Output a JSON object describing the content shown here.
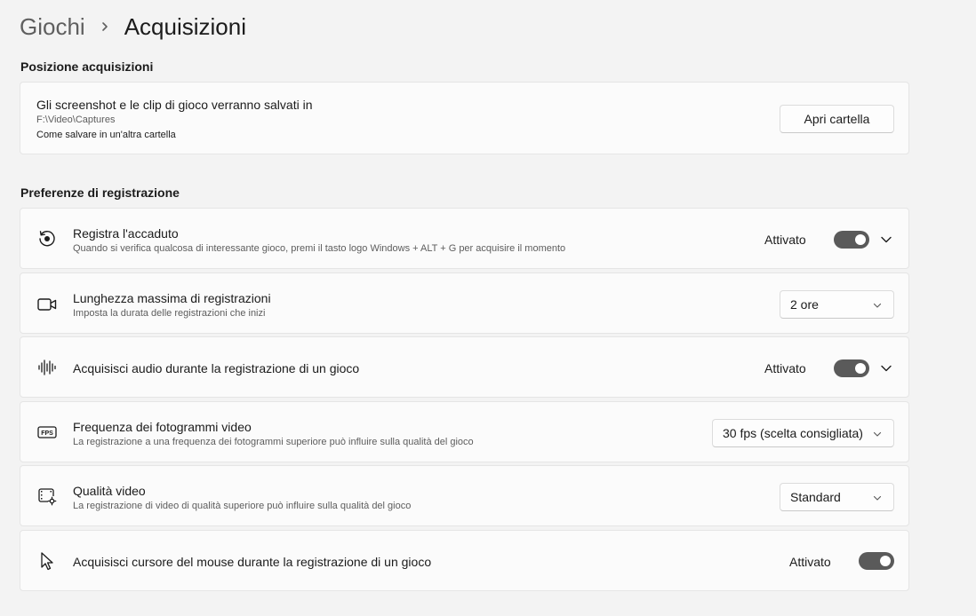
{
  "breadcrumb": {
    "parent": "Giochi",
    "current": "Acquisizioni"
  },
  "location_section": {
    "title": "Posizione acquisizioni",
    "description": "Gli screenshot e le clip di gioco verranno salvati in",
    "path": "F:\\Video\\Captures",
    "link": "Come salvare in un'altra cartella",
    "button": "Apri cartella"
  },
  "recording_section": {
    "title": "Preferenze di registrazione",
    "rows": [
      {
        "icon": "record-history-icon",
        "title": "Registra l'accaduto",
        "subtitle": "Quando si verifica qualcosa di interessante gioco, premi il tasto logo Windows + ALT + G per acquisire il momento",
        "state": "Attivato"
      },
      {
        "icon": "video-camera-icon",
        "title": "Lunghezza massima di registrazioni",
        "subtitle": "Imposta la durata delle registrazioni che inizi",
        "value": "2 ore"
      },
      {
        "icon": "audio-waveform-icon",
        "title": "Acquisisci audio durante la registrazione di un gioco",
        "state": "Attivato"
      },
      {
        "icon": "fps-icon",
        "title": "Frequenza dei fotogrammi video",
        "subtitle": "La registrazione a una frequenza dei fotogrammi superiore può influire sulla qualità del gioco",
        "value": "30 fps (scelta consigliata)"
      },
      {
        "icon": "video-settings-icon",
        "title": "Qualità video",
        "subtitle": "La registrazione di video di qualità superiore può influire sulla qualità del gioco",
        "value": "Standard"
      },
      {
        "icon": "mouse-cursor-icon",
        "title": "Acquisisci cursore del mouse durante la registrazione di un gioco",
        "state": "Attivato"
      }
    ]
  }
}
